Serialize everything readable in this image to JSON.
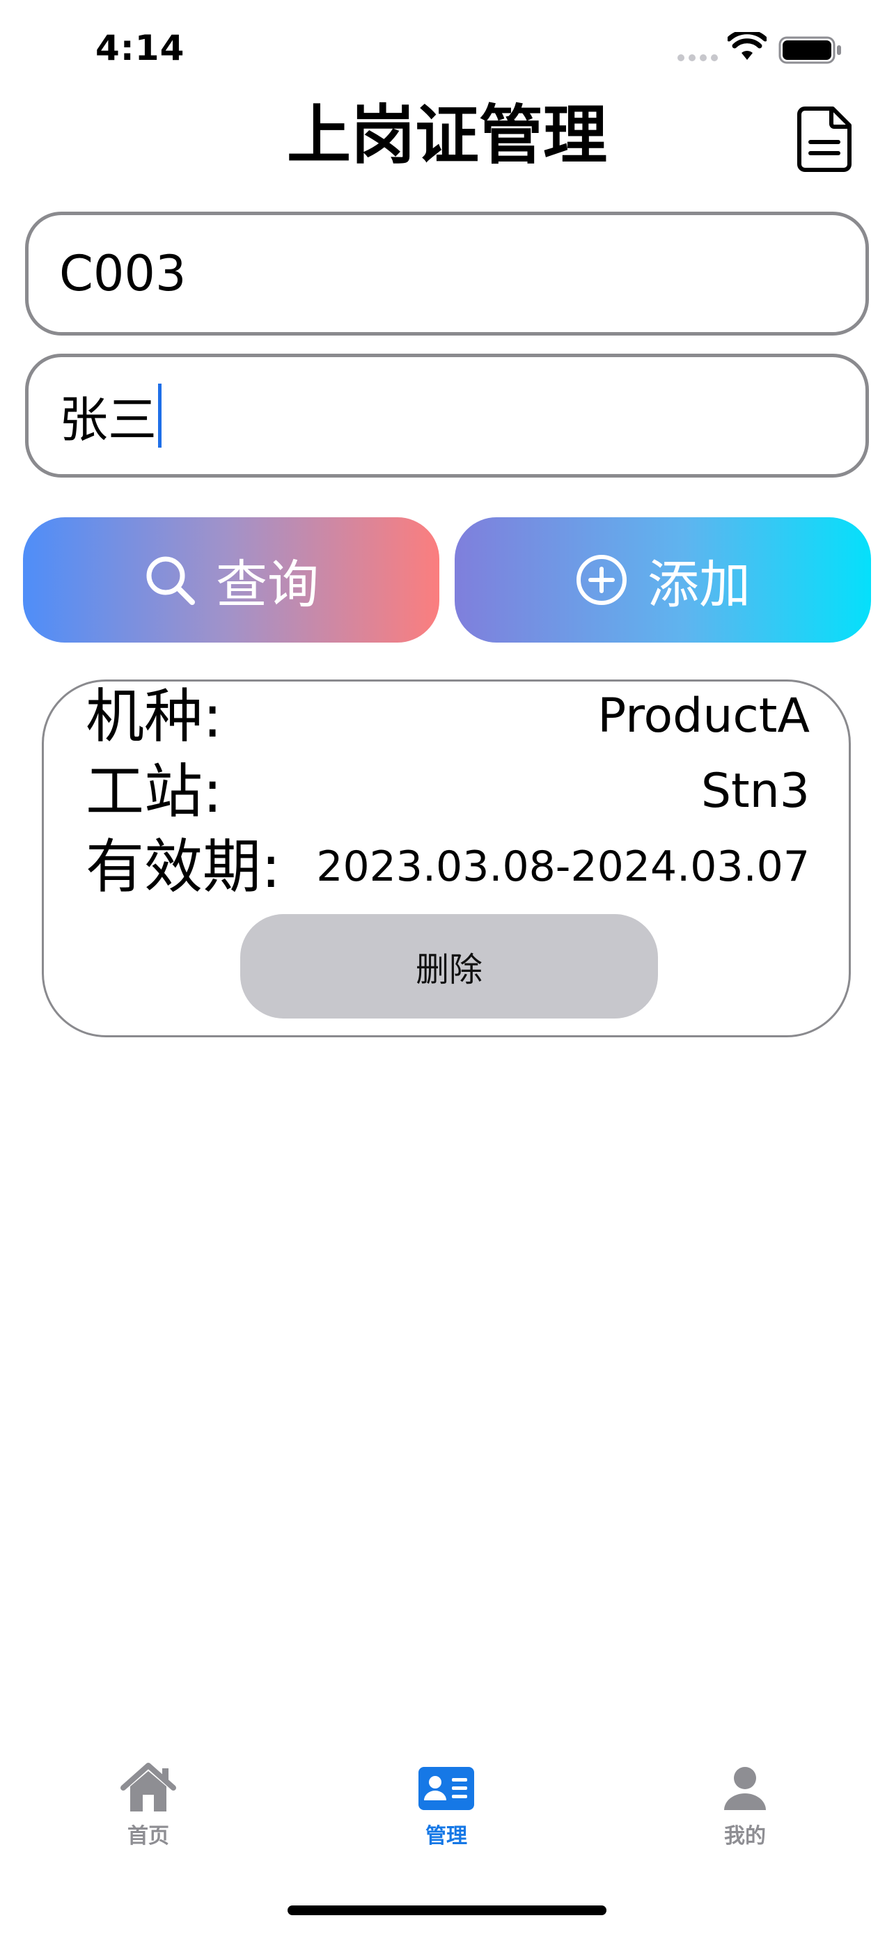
{
  "status_bar": {
    "time": "4:14",
    "icons": [
      "signal-dots-icon",
      "wifi-icon",
      "battery-icon"
    ]
  },
  "header": {
    "title": "上岗证管理",
    "action_icon": "document-icon"
  },
  "form": {
    "code_value": "C003",
    "name_value": "张三"
  },
  "actions": {
    "query_label": "查询",
    "query_icon": "search-icon",
    "add_label": "添加",
    "add_icon": "plus-circle-icon"
  },
  "record": {
    "model_label": "机种:",
    "model_value": "ProductA",
    "station_label": "工站:",
    "station_value": "Stn3",
    "validity_label": "有效期:",
    "validity_value": "2023.03.08-2024.03.07",
    "delete_label": "删除"
  },
  "tab_bar": {
    "items": [
      {
        "label": "首页",
        "icon": "home-icon",
        "active": false
      },
      {
        "label": "管理",
        "icon": "id-card-icon",
        "active": true
      },
      {
        "label": "我的",
        "icon": "person-icon",
        "active": false
      }
    ],
    "active_color": "#1678e6",
    "inactive_color": "#8e8e93"
  },
  "colors": {
    "query_gradient": [
      "#4f8ef8",
      "#fb7e7e"
    ],
    "add_gradient": [
      "#7f7fdc",
      "#05e0fb"
    ],
    "delete_bg": "#c7c7cc"
  }
}
